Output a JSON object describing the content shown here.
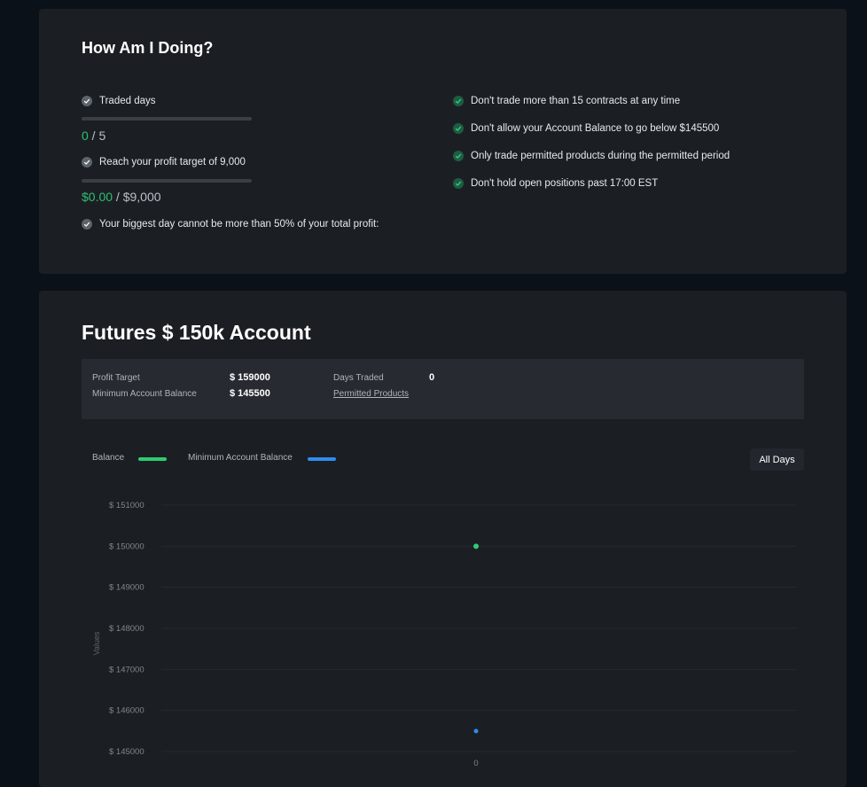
{
  "progress": {
    "title": "How Am I Doing?",
    "left_items": [
      {
        "label": "Traded days",
        "current": "0",
        "target": "5",
        "fraction": 0
      },
      {
        "label": "Reach your profit target of 9,000",
        "current": "$0.00",
        "target": "$9,000",
        "fraction": 0
      },
      {
        "label": "Your biggest day cannot be more than 50% of your total profit:"
      }
    ],
    "separator": " / ",
    "right_items": [
      {
        "label": "Don't trade more than 15 contracts at any time"
      },
      {
        "label": "Don't allow your Account Balance to go below $145500"
      },
      {
        "label": "Only trade permitted products during the permitted period"
      },
      {
        "label": "Don't hold open positions past 17:00 EST"
      }
    ]
  },
  "account": {
    "title": "Futures $ 150k Account",
    "stats": {
      "profit_target_label": "Profit Target",
      "profit_target_value": "$ 159000",
      "min_balance_label": "Minimum Account Balance",
      "min_balance_value": "$ 145500",
      "days_traded_label": "Days Traded",
      "days_traded_value": "0",
      "permitted_products_link": "Permitted Products"
    },
    "filter_button": "All Days"
  },
  "colors": {
    "balance": "#2ecc71",
    "min_balance": "#2f8cf0",
    "check_green": "#2ecc71",
    "check_grey": "#5c636b"
  },
  "chart_data": {
    "type": "scatter",
    "ylabel": "Values",
    "x_categories": [
      "0"
    ],
    "y_ticks": [
      "$ 151000",
      "$ 150000",
      "$ 149000",
      "$ 148000",
      "$ 147000",
      "$ 146000",
      "$ 145000"
    ],
    "ylim": [
      145000,
      151000
    ],
    "legend_placement": "top-left",
    "series": [
      {
        "name": "Balance",
        "color": "#2ecc71",
        "points": [
          {
            "x": "0",
            "y": 150000
          }
        ]
      },
      {
        "name": "Minimum Account Balance",
        "color": "#2f8cf0",
        "points": [
          {
            "x": "0",
            "y": 145500
          }
        ]
      }
    ]
  }
}
